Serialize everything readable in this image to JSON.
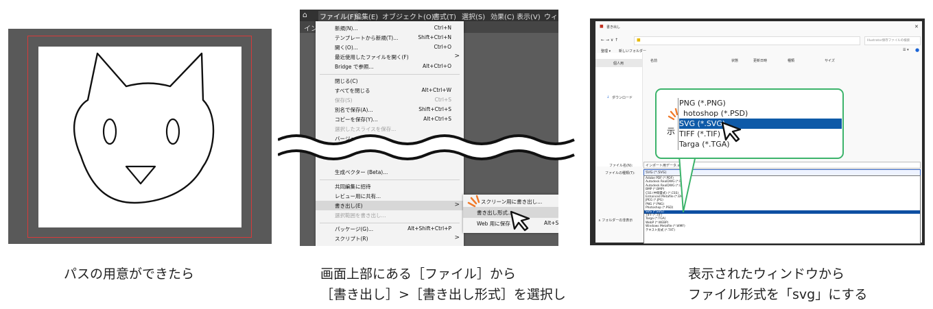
{
  "panel1": {
    "caption": "パスの用意ができたら"
  },
  "panel2": {
    "caption_line1": "画面上部にある［ファイル］から",
    "caption_line2": "［書き出し］>［書き出し形式］を選択し",
    "menubar": {
      "file": "ファイル(F)",
      "edit": "編集(E)",
      "object": "オブジェクト(O)",
      "type": "書式(T)",
      "select": "選択(S)",
      "effect": "効果(C)",
      "view": "表示(V)",
      "window": "ウィンドウ"
    },
    "tab_label": "インポ",
    "menu": [
      {
        "label": "新規(N)...",
        "shortcut": "Ctrl+N"
      },
      {
        "label": "テンプレートから新規(T)...",
        "shortcut": "Shift+Ctrl+N"
      },
      {
        "label": "開く(O)...",
        "shortcut": "Ctrl+O"
      },
      {
        "label": "最近使用したファイルを開く(F)",
        "arrow": ">"
      },
      {
        "label": "Bridge で参照...",
        "shortcut": "Alt+Ctrl+O"
      },
      {
        "label": "閉じる(C)",
        "shortcut": ""
      },
      {
        "label": "すべてを閉じる",
        "shortcut": "Alt+Ctrl+W"
      },
      {
        "label": "保存(S)",
        "shortcut": "Ctrl+S"
      },
      {
        "label": "別名で保存(A)...",
        "shortcut": "Shift+Ctrl+S"
      },
      {
        "label": "コピーを保存(Y)...",
        "shortcut": "Alt+Ctrl+S"
      },
      {
        "label": "選択したスライスを保存...",
        "shortcut": ""
      },
      {
        "label": "バージョン履歴",
        "shortcut": ""
      },
      {
        "label": "生成ベクター (Beta)...",
        "shortcut": ""
      },
      {
        "label": "共同編集に招待",
        "shortcut": ""
      },
      {
        "label": "レビュー用に共有...",
        "shortcut": ""
      },
      {
        "label": "書き出し(E)",
        "arrow": ">"
      },
      {
        "label": "選択範囲を書き出し...",
        "shortcut": ""
      },
      {
        "label": "パッケージ(G)...",
        "shortcut": "Alt+Shift+Ctrl+P"
      },
      {
        "label": "スクリプト(R)",
        "arrow": ">"
      }
    ],
    "submenu": [
      {
        "label": "スクリーン用に書き出し..."
      },
      {
        "label": "書き出し形式..."
      },
      {
        "label": "Web 用に保存",
        "shortcut": "Alt+S"
      }
    ]
  },
  "panel3": {
    "caption_line1": "表示されたウィンドウから",
    "caption_line2": "ファイル形式を「svg」にする",
    "dialog_title": "書き出し",
    "search_placeholder": "Illustrator保存ファイルの検索",
    "toolbar_left": "整理 ▾",
    "new_folder": "新しいフォルダー",
    "nav_selected": "個人用",
    "nav_download": "ダウンロード",
    "col_name": "名前",
    "col_status": "状態",
    "col_modified": "更新日時",
    "col_type": "種類",
    "col_size": "サイズ",
    "filename_label": "ファイル名(N):",
    "filename_value": "インポート用データ.svg",
    "filetype_label": "ファイルの種類(T):",
    "filetype_value": "SVG (*.SVG)",
    "folder_toggle": "∧ フォルダーの非表示",
    "dropdown_options": [
      "Adobe PDF (*.PDF)",
      "Autodesk RealDWG (*.DXF)",
      "Autodesk RealDWG (*.DWG)",
      "BMP (*.BMP)",
      "CSS (中間書式) (*.CSS)",
      "Enhanced Metafile (*.EMF)",
      "JPEG (*.JPG)",
      "PNG (*.PNG)",
      "Photoshop (*.PSD)",
      "SVG (*.SVG)",
      "TIFF (*.TIF)",
      "Targa (*.TGA)",
      "WebP (*.WEBP)",
      "Windows Metafile (*.WMF)",
      "テキスト形式 (*.TXT)"
    ],
    "dropdown_selected_index": 9,
    "callout_options": [
      "PNG (*.PNG)",
      "hotoshop (*.PSD)",
      "SVG (*.SVG)",
      "TIFF (*.TIF)",
      "Targa (*.TGA)"
    ],
    "callout_selected_index": 2,
    "callout_side_char": "示"
  },
  "colors": {
    "canvas_gray": "#595959",
    "artboard_red": "#d93a3a",
    "callout_green": "#3bb36a",
    "selection_blue": "#0e5aa8",
    "click_mark_orange": "#f07a2a"
  }
}
